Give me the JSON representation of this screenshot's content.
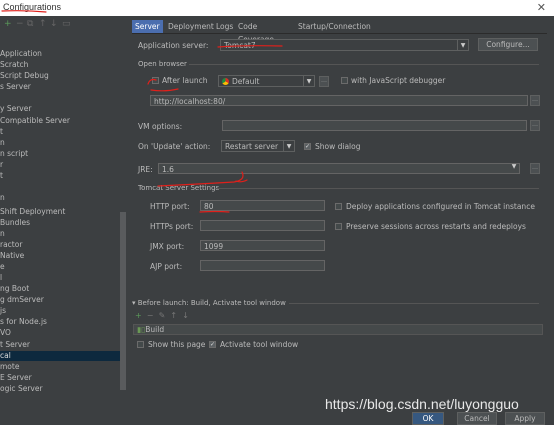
{
  "window": {
    "title": "Configurations",
    "close": "✕"
  },
  "sidebar": {
    "items": [
      {
        "label": "Application"
      },
      {
        "label": "Scratch"
      },
      {
        "label": "Script Debug"
      },
      {
        "label": "s Server"
      },
      {
        "label": ""
      },
      {
        "label": "y Server"
      },
      {
        "label": " Compatible Server"
      },
      {
        "label": "t"
      },
      {
        "label": "n"
      },
      {
        "label": "n script"
      },
      {
        "label": "r"
      },
      {
        "label": "t"
      },
      {
        "label": ""
      },
      {
        "label": "n"
      },
      {
        "label": "Shift Deployment"
      },
      {
        "label": "Bundles"
      },
      {
        "label": "n"
      },
      {
        "label": "ractor"
      },
      {
        "label": "Native"
      },
      {
        "label": "e"
      },
      {
        "label": "l"
      },
      {
        "label": "ng Boot"
      },
      {
        "label": "g dmServer"
      },
      {
        "label": "js"
      },
      {
        "label": "s for Node.js"
      },
      {
        "label": "VO"
      },
      {
        "label": "t Server"
      },
      {
        "label": "cal"
      },
      {
        "label": "mote"
      },
      {
        "label": "E Server"
      },
      {
        "label": "ogic Server"
      }
    ],
    "selected_index": 27
  },
  "tabs": [
    {
      "label": "Server"
    },
    {
      "label": "Deployment"
    },
    {
      "label": "Logs"
    },
    {
      "label": "Code Coverage"
    },
    {
      "label": "Startup/Connection"
    }
  ],
  "server": {
    "app_server_label": "Application server:",
    "app_server_value": "Tomcat7",
    "configure_button": "Configure...",
    "open_browser_label": "Open browser",
    "after_launch_label": "After launch",
    "after_launch_checked": false,
    "browser_value": "Default",
    "js_debugger_label": "with JavaScript debugger",
    "js_debugger_checked": false,
    "url_value": "http://localhost:80/",
    "vm_options_label": "VM options:",
    "vm_options_value": "",
    "on_update_label": "On 'Update' action:",
    "on_update_value": "Restart server",
    "show_dialog_label": "Show dialog",
    "show_dialog_checked": true,
    "jre_label": "JRE:",
    "jre_value": "1.6",
    "tomcat_settings_label": "Tomcat Server Settings",
    "http_port_label": "HTTP port:",
    "http_port_value": "80",
    "https_port_label": "HTTPs port:",
    "https_port_value": "",
    "jmx_port_label": "JMX port:",
    "jmx_port_value": "1099",
    "ajp_port_label": "AJP port:",
    "ajp_port_value": "",
    "deploy_apps_label": "Deploy applications configured in Tomcat instance",
    "deploy_apps_checked": false,
    "preserve_sessions_label": "Preserve sessions across restarts and redeploys",
    "preserve_sessions_checked": false
  },
  "before_launch": {
    "header": "Before launch: Build, Activate tool window",
    "item": "Build",
    "show_page_label": "Show this page",
    "show_page_checked": false,
    "activate_label": "Activate tool window",
    "activate_checked": true
  },
  "footer": {
    "ok": "OK",
    "cancel": "Cancel",
    "apply": "Apply"
  },
  "watermark": "https://blog.csdn.net/luyongguo",
  "colors": {
    "accent": "#4b6eaf",
    "annotation": "#e0201b",
    "background": "#3c3f41"
  }
}
